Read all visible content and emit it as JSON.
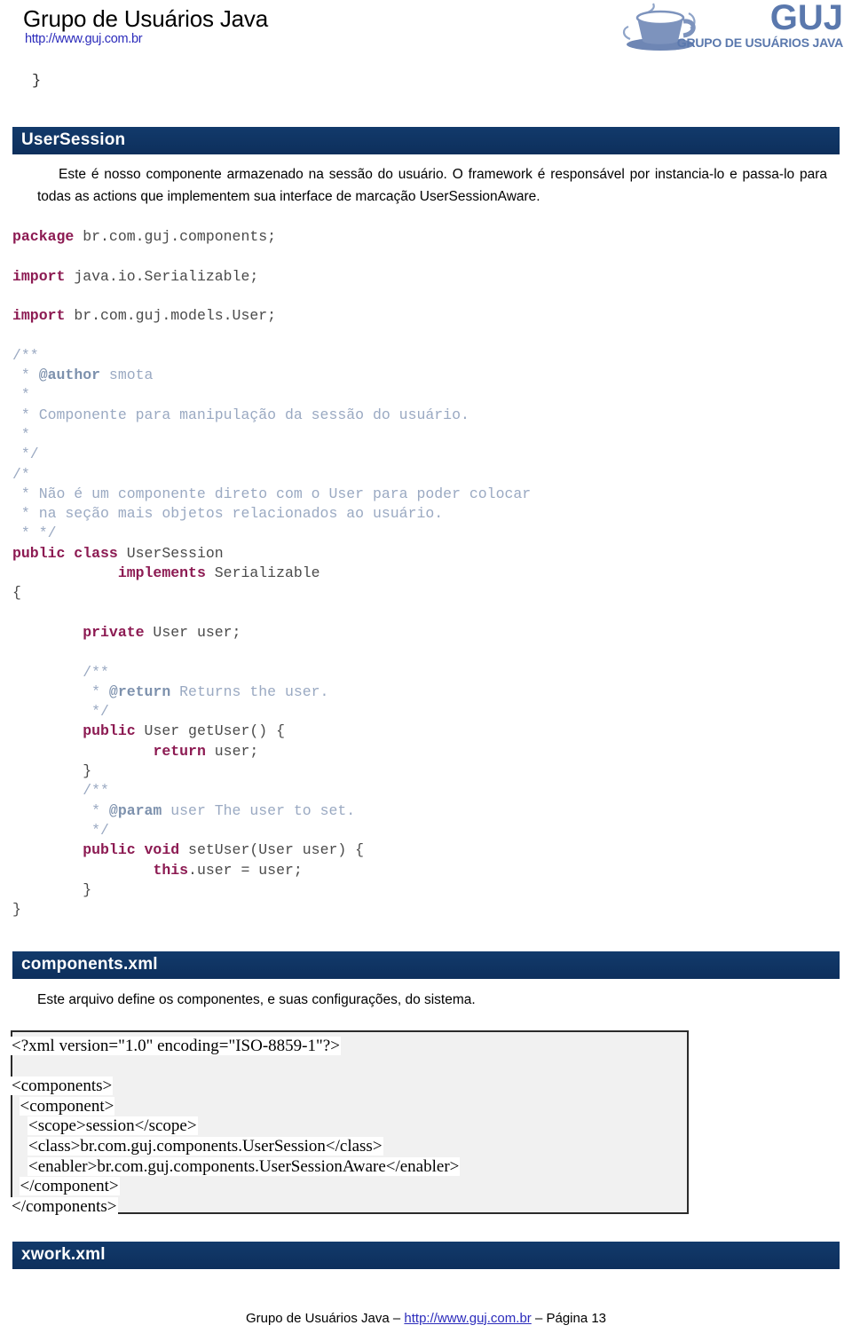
{
  "header": {
    "title": "Grupo de Usuários Java",
    "url": "http://www.guj.com.br",
    "logo": {
      "brand": "GUJ",
      "subtitle": "GRUPO DE USUÁRIOS JAVA",
      "icon": "coffee-cup-icon",
      "color": "#5a78ad"
    }
  },
  "colors": {
    "section_bar": "#123A6B",
    "link": "#2b2bbb",
    "code_keyword": "#8c1a52",
    "code_comment": "#9aa9c2",
    "code_tag": "#7d91ad",
    "code_plain": "#4a4a4a",
    "xml_box_bg": "#f1f1f1",
    "xml_box_border": "#2b2b2b"
  },
  "stray_brace": "}",
  "sections": [
    {
      "id": "usersession",
      "title": "UserSession"
    },
    {
      "id": "components-xml",
      "title": "components.xml"
    },
    {
      "id": "xwork-xml",
      "title": "xwork.xml"
    }
  ],
  "usersession": {
    "title": "UserSession",
    "paragraph_parts": [
      {
        "text": "Este é nosso componente armazenado na sessão do usuário. O framework é responsável por instancia-lo e passa-lo para todas as actions que implementem sua interface de marcação ",
        "bold": false
      },
      {
        "text": "UserSessionAware",
        "bold": true
      },
      {
        "text": ".",
        "bold": false
      }
    ],
    "paragraph_plain": "Este é nosso componente armazenado na sessão do usuário. O framework é responsável por instancia-lo e passa-lo para todas as actions que implementem sua interface de marcação UserSessionAware."
  },
  "java_code": {
    "language": "java",
    "lines": [
      [
        {
          "t": "package",
          "c": "kw"
        },
        {
          "t": " br.com.guj.components;",
          "c": "pln"
        }
      ],
      [],
      [
        {
          "t": "import",
          "c": "kw"
        },
        {
          "t": " java.io.Serializable;",
          "c": "pln"
        }
      ],
      [],
      [
        {
          "t": "import",
          "c": "kw"
        },
        {
          "t": " br.com.guj.models.User;",
          "c": "pln"
        }
      ],
      [],
      [
        {
          "t": "/**",
          "c": "cmt"
        }
      ],
      [
        {
          "t": " * ",
          "c": "cmt"
        },
        {
          "t": "@author",
          "c": "tag"
        },
        {
          "t": " smota",
          "c": "cmt"
        }
      ],
      [
        {
          "t": " *",
          "c": "cmt"
        }
      ],
      [
        {
          "t": " * Componente para manipulação da sessão do usuário.",
          "c": "cmt"
        }
      ],
      [
        {
          "t": " *",
          "c": "cmt"
        }
      ],
      [
        {
          "t": " */",
          "c": "cmt"
        }
      ],
      [
        {
          "t": "/*",
          "c": "cmt"
        }
      ],
      [
        {
          "t": " * Não é um componente direto com o User para poder colocar",
          "c": "cmt"
        }
      ],
      [
        {
          "t": " * na seção mais objetos relacionados ao usuário.",
          "c": "cmt"
        }
      ],
      [
        {
          "t": " * */",
          "c": "cmt"
        }
      ],
      [
        {
          "t": "public class",
          "c": "kw"
        },
        {
          "t": " UserSession",
          "c": "pln"
        }
      ],
      [
        {
          "t": "            ",
          "c": "pln"
        },
        {
          "t": "implements",
          "c": "kw"
        },
        {
          "t": " Serializable",
          "c": "pln"
        }
      ],
      [
        {
          "t": "{",
          "c": "pln"
        }
      ],
      [],
      [
        {
          "t": "        ",
          "c": "pln"
        },
        {
          "t": "private",
          "c": "kw"
        },
        {
          "t": " User user;",
          "c": "pln"
        }
      ],
      [],
      [
        {
          "t": "        ",
          "c": "cmt"
        },
        {
          "t": "/**",
          "c": "cmt"
        }
      ],
      [
        {
          "t": "         * ",
          "c": "cmt"
        },
        {
          "t": "@return",
          "c": "tag"
        },
        {
          "t": " Returns the user.",
          "c": "cmt"
        }
      ],
      [
        {
          "t": "         */",
          "c": "cmt"
        }
      ],
      [
        {
          "t": "        ",
          "c": "pln"
        },
        {
          "t": "public",
          "c": "kw"
        },
        {
          "t": " User getUser() {",
          "c": "pln"
        }
      ],
      [
        {
          "t": "                ",
          "c": "pln"
        },
        {
          "t": "return",
          "c": "kw"
        },
        {
          "t": " user;",
          "c": "pln"
        }
      ],
      [
        {
          "t": "        }",
          "c": "pln"
        }
      ],
      [
        {
          "t": "        ",
          "c": "cmt"
        },
        {
          "t": "/**",
          "c": "cmt"
        }
      ],
      [
        {
          "t": "         * ",
          "c": "cmt"
        },
        {
          "t": "@param",
          "c": "tag"
        },
        {
          "t": " user The user to set.",
          "c": "cmt"
        }
      ],
      [
        {
          "t": "         */",
          "c": "cmt"
        }
      ],
      [
        {
          "t": "        ",
          "c": "pln"
        },
        {
          "t": "public void",
          "c": "kw"
        },
        {
          "t": " setUser(User user) {",
          "c": "pln"
        }
      ],
      [
        {
          "t": "                ",
          "c": "pln"
        },
        {
          "t": "this",
          "c": "kw"
        },
        {
          "t": ".user = user;",
          "c": "pln"
        }
      ],
      [
        {
          "t": "        }",
          "c": "pln"
        }
      ],
      [
        {
          "t": "}",
          "c": "pln"
        }
      ]
    ]
  },
  "components_xml": {
    "title": "components.xml",
    "paragraph": "Este arquivo define os componentes, e suas configurações, do sistema.",
    "code_lines": [
      "<?xml version=\"1.0\" encoding=\"ISO-8859-1\"?>",
      "",
      "<components>",
      "  <component>",
      "    <scope>session</scope>",
      "    <class>br.com.guj.components.UserSession</class>",
      "    <enabler>br.com.guj.components.UserSessionAware</enabler>",
      "  </component>",
      "</components>"
    ]
  },
  "xwork_xml": {
    "title": "xwork.xml"
  },
  "footer": {
    "org": "Grupo de Usuários Java",
    "sep1": " – ",
    "url": "http://www.guj.com.br",
    "sep2": " – ",
    "page": "Página 13"
  }
}
